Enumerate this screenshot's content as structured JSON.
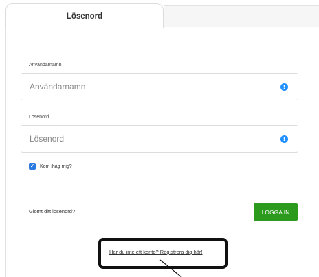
{
  "tabs": {
    "active_label": "Lösenord",
    "inactive_label": ""
  },
  "username": {
    "label": "Användarnamn",
    "placeholder": "Användarnamn",
    "value": ""
  },
  "password": {
    "label": "Lösenord",
    "placeholder": "Lösenord",
    "value": ""
  },
  "info_icon_glyph": "!",
  "remember": {
    "label": "Kom ihåg mig?",
    "checked": true,
    "check_glyph": "✓"
  },
  "forgot_link": "Glömt ditt lösenord?",
  "login_button": "LOGGA IN",
  "register_link": "Har du inte ett konto? Registrera dig här!",
  "colors": {
    "login_button_bg": "#2c9a1c",
    "checkbox_bg": "#2a7ae2",
    "info_icon": "#1e90ff",
    "highlight_border": "#111111"
  },
  "icons": {
    "field_info": "info-circle-icon",
    "checkbox": "checkmark-icon"
  }
}
